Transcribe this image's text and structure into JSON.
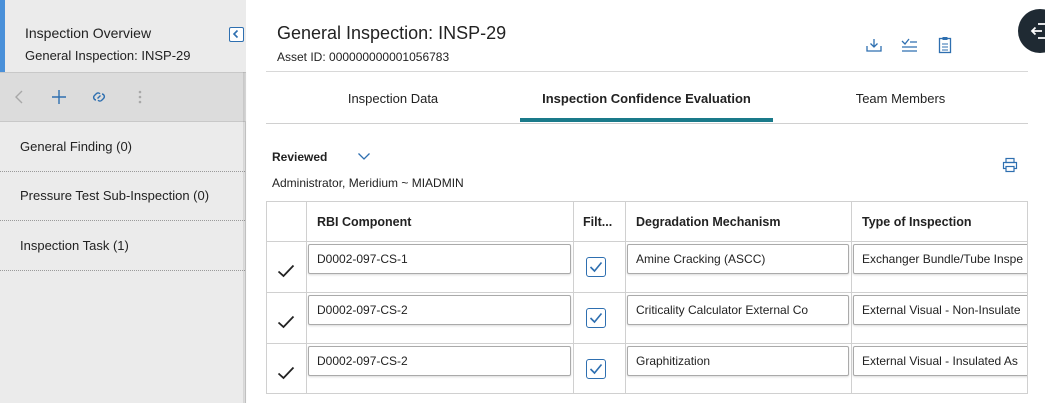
{
  "sidebar": {
    "title": "Inspection Overview",
    "subtitle": "General Inspection: INSP-29",
    "toolbar": {
      "back_icon": "chevron-left-icon",
      "add_icon": "plus-icon",
      "link_icon": "link-icon",
      "more_icon": "more-vertical-icon"
    },
    "items": [
      {
        "label": "General Finding (0)"
      },
      {
        "label": "Pressure Test Sub-Inspection (0)"
      },
      {
        "label": "Inspection Task (1)"
      }
    ]
  },
  "main": {
    "header": {
      "title": "General Inspection: INSP-29",
      "asset_id": "Asset ID: 000000000001056783",
      "icons": [
        "download-icon",
        "checklist-icon",
        "clipboard-icon",
        "exit-icon"
      ]
    },
    "tabs": [
      {
        "label": "Inspection Data",
        "active": false
      },
      {
        "label": "Inspection Confidence Evaluation",
        "active": true
      },
      {
        "label": "Team Members",
        "active": false
      }
    ],
    "filter": {
      "selected": "Reviewed",
      "user": "Administrator, Meridium ~ MIADMIN"
    },
    "grid": {
      "columns": [
        "RBI Component",
        "Filt...",
        "Degradation Mechanism",
        "Type of Inspection"
      ],
      "rows": [
        {
          "checked": true,
          "component": "D0002-097-CS-1",
          "filter": true,
          "mechanism": "Amine Cracking (ASCC)",
          "inspection_type": "Exchanger Bundle/Tube Inspe"
        },
        {
          "checked": true,
          "component": "D0002-097-CS-2",
          "filter": true,
          "mechanism": "Criticality Calculator External Co",
          "inspection_type": "External Visual - Non-Insulate"
        },
        {
          "checked": true,
          "component": "D0002-097-CS-2",
          "filter": true,
          "mechanism": "Graphitization",
          "inspection_type": "External Visual - Insulated As"
        }
      ]
    }
  },
  "colors": {
    "accent_tab": "#1a7a8a",
    "icon_blue": "#2e6fb0",
    "sidebar_bg": "#ebebeb",
    "fab_bg": "#1f2a33"
  }
}
